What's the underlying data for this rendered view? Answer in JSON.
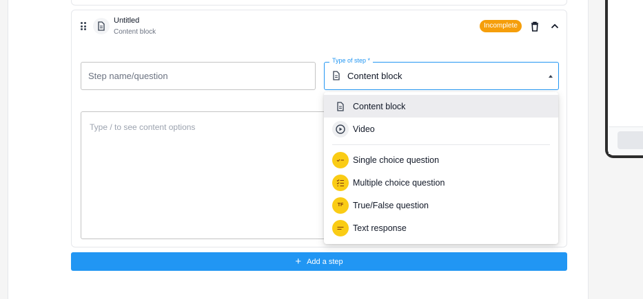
{
  "step": {
    "title": "Untitled",
    "subtitle": "Content block",
    "status": "Incomplete",
    "status_color": "#f59e0b"
  },
  "form": {
    "name_placeholder": "Step name/question",
    "name_value": "",
    "editor_placeholder": "Type / to see content options",
    "type_label": "Type of step *",
    "type_value": "Content block"
  },
  "dropdown": {
    "options": [
      {
        "label": "Content block",
        "icon": "document-icon",
        "selected": true
      },
      {
        "label": "Video",
        "icon": "play-circle-icon",
        "selected": false
      },
      {
        "label": "Single choice question",
        "icon": "single-choice-icon",
        "selected": false
      },
      {
        "label": "Multiple choice question",
        "icon": "checklist-icon",
        "selected": false
      },
      {
        "label": "True/False question",
        "icon": "true-false-icon",
        "icon_text": "TF",
        "selected": false
      },
      {
        "label": "Text response",
        "icon": "text-lines-icon",
        "selected": false
      }
    ]
  },
  "actions": {
    "add_step_label": "Add a step"
  },
  "colors": {
    "accent": "#2196f3",
    "question_icon": "#facc15",
    "badge": "#f59e0b"
  }
}
